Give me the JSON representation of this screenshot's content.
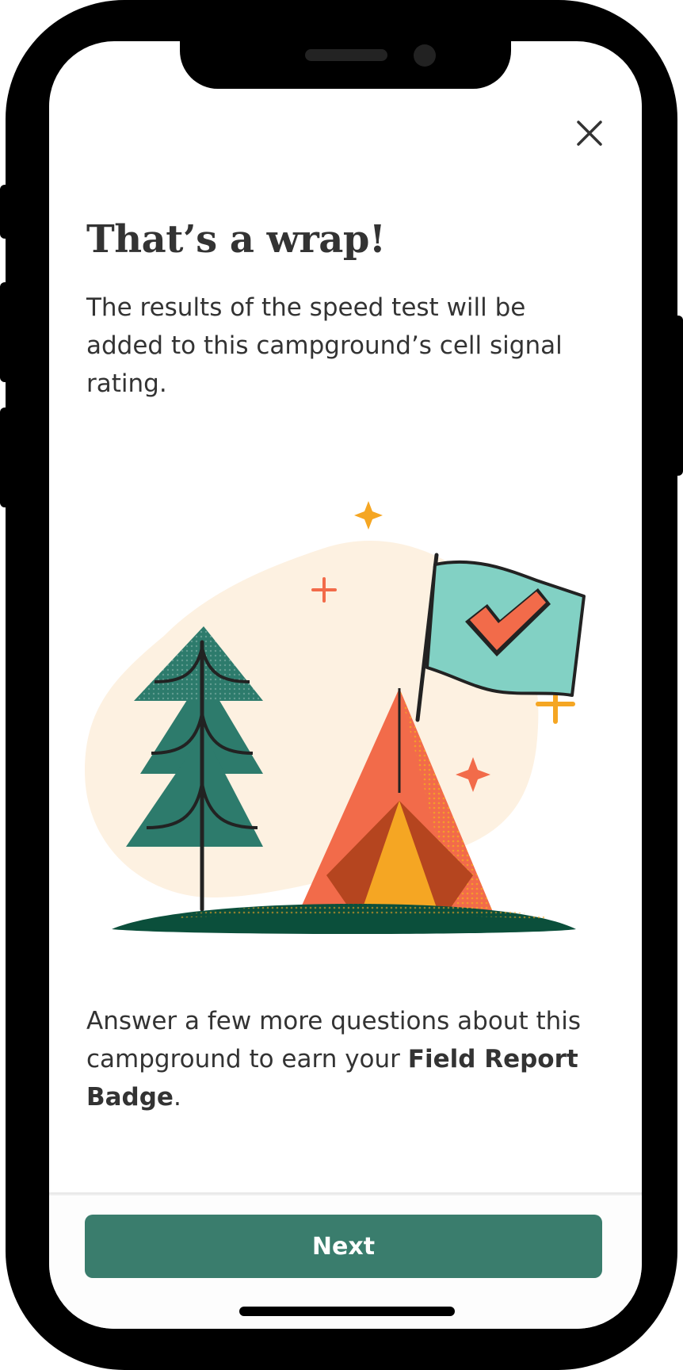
{
  "screen": {
    "title": "That’s a wrap!",
    "lead": "The results of the speed test will be added to this campground’s cell signal rating.",
    "body": {
      "text_before": "Answer a few more questions about this campground to earn your ",
      "badge_name": "Field Report Badge",
      "text_after": "."
    },
    "close_icon": "close-icon",
    "illustration": "camping-tent-flag-illustration"
  },
  "footer": {
    "next_label": "Next"
  },
  "colors": {
    "primary_button": "#3a7d6d",
    "text": "#333333",
    "tent": "#f26b4a",
    "tent_inner": "#f5a623",
    "tree": "#2d7b6c",
    "flag": "#82d1c4",
    "ground": "#0b4f3b",
    "blob": "#fdf1e1"
  }
}
